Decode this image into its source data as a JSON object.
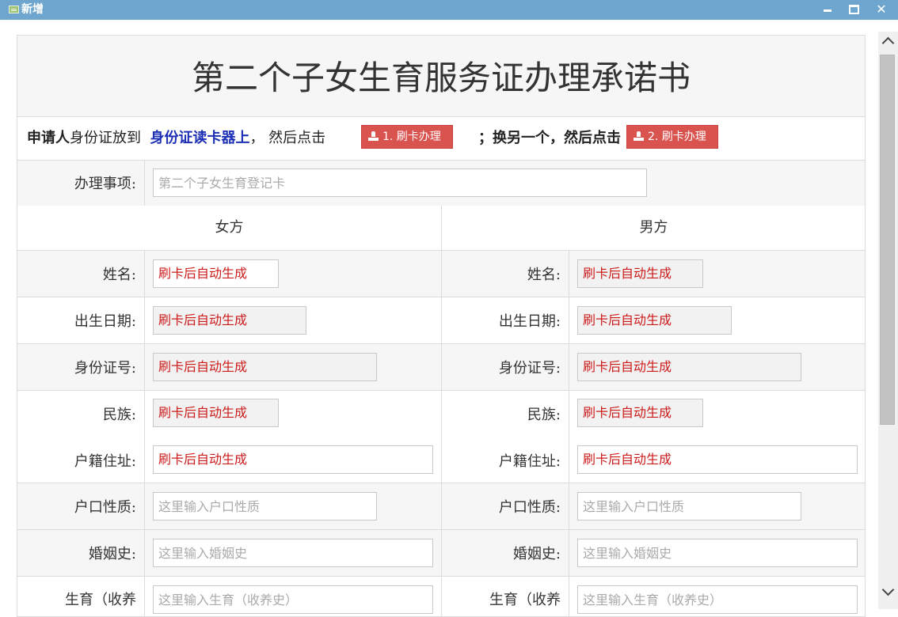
{
  "window": {
    "title": "新增"
  },
  "form_title": "第二个子女生育服务证办理承诺书",
  "instructions": {
    "applicant": "申请人",
    "part1": "身份证放到",
    "reader": "身份证读卡器上",
    "part2": "，  然后点击",
    "part3": "；换另一个，然后点击",
    "button1": "1. 刷卡办理",
    "button2": "2. 刷卡办理"
  },
  "item": {
    "label": "办理事项:",
    "value": "第二个子女生育登记卡"
  },
  "columns": {
    "female": "女方",
    "male": "男方"
  },
  "auto_text": "刷卡后自动生成",
  "rows": [
    {
      "label": "姓名:"
    },
    {
      "label": "出生日期:"
    },
    {
      "label": "身份证号:"
    },
    {
      "label": "民族:"
    },
    {
      "label": "户籍住址:"
    },
    {
      "label": "户口性质:",
      "placeholder": "这里输入户口性质"
    },
    {
      "label": "婚姻史:",
      "placeholder": "这里输入婚姻史"
    },
    {
      "label": "生育（收养",
      "placeholder": "这里输入生育（收养史）"
    }
  ],
  "colors": {
    "titlebar": "#6fa6cf",
    "button": "#d9534f",
    "generated_text": "#cc1a1a",
    "highlight": "#1c2fb5"
  }
}
